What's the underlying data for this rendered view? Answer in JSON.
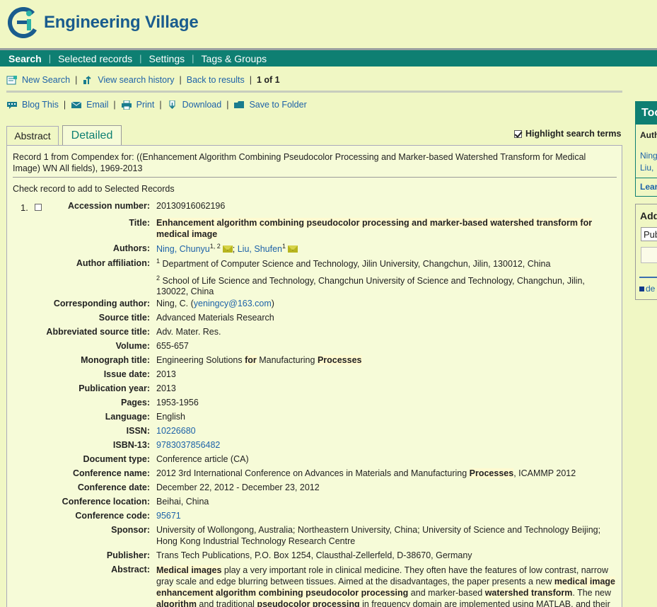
{
  "app": {
    "logo_text": "Engineering Village"
  },
  "nav": [
    "Search",
    "Selected records",
    "Settings",
    "Tags & Groups"
  ],
  "toolbar1": {
    "new_search": "New Search",
    "view_history": "View search history",
    "back": "Back to results",
    "count": "1 of 1"
  },
  "toolbar2": {
    "blog": "Blog This",
    "email": "Email",
    "print": "Print",
    "download": "Download",
    "save": "Save to Folder"
  },
  "tabs": {
    "abstract": "Abstract",
    "detailed": "Detailed"
  },
  "highlight_label": "Highlight search terms",
  "record_from": "Record 1 from Compendex for: ((Enhancement Algorithm Combining Pseudocolor Processing and Marker-based Watershed Transform for Medical Image) WN All fields), 1969-2013",
  "check_note": "Check record to add to Selected Records",
  "record_number": "1.",
  "labels": {
    "accession": "Accession number:",
    "title": "Title:",
    "authors": "Authors:",
    "affiliation": "Author affiliation:",
    "corresponding": "Corresponding author:",
    "source": "Source title:",
    "abbrev": "Abbreviated source title:",
    "volume": "Volume:",
    "monograph": "Monograph title:",
    "issue_date": "Issue date:",
    "pub_year": "Publication year:",
    "pages": "Pages:",
    "language": "Language:",
    "issn": "ISSN:",
    "isbn": "ISBN-13:",
    "doctype": "Document type:",
    "conf_name": "Conference name:",
    "conf_date": "Conference date:",
    "conf_loc": "Conference location:",
    "conf_code": "Conference code:",
    "sponsor": "Sponsor:",
    "publisher": "Publisher:",
    "abstract": "Abstract:"
  },
  "record": {
    "accession": "20130916062196",
    "title": "Enhancement algorithm combining pseudocolor processing and marker-based watershed transform for medical image",
    "author1": "Ning, Chunyu",
    "author1_sup": "1, 2",
    "author_sep": ";",
    "author2": "Liu, Shufen",
    "author2_sup": "1",
    "aff1_sup": "1",
    "aff1": "Department of Computer Science and Technology, Jilin University, Changchun, Jilin, 130012, China",
    "aff2_sup": "2",
    "aff2": "School of Life Science and Technology, Changchun University of Science and Technology, Changchun, Jilin, 130022, China",
    "corr_name": "Ning, C. (",
    "corr_email": "yeningcy@163.com",
    "corr_close": ")",
    "source": "Advanced Materials Research",
    "abbrev": "Adv. Mater. Res.",
    "volume": "655-657",
    "mono_a": "Engineering Solutions ",
    "mono_b": "for",
    "mono_c": " Manufacturing ",
    "mono_d": "Processes",
    "issue_date": "2013",
    "pub_year": "2013",
    "pages": "1953-1956",
    "language": "English",
    "issn": "10226680",
    "isbn": "9783037856482",
    "doctype": "Conference article (CA)",
    "conf_a": "2012 3rd International Conference on Advances in Materials and Manufacturing ",
    "conf_b": "Processes",
    "conf_c": ", ICAMMP 2012",
    "conf_date": "December 22, 2012 - December 23, 2012",
    "conf_loc": "Beihai, China",
    "conf_code": "95671",
    "sponsor": "University of Wollongong, Australia; Northeastern University, China; University of Science and Technology Beijing; Hong Kong Industrial Technology Research Centre",
    "publisher": "Trans Tech Publications, P.O. Box 1254, Clausthal-Zellerfeld, D-38670, Germany",
    "abs_1": "Medical images",
    "abs_2": " play a very important role in clinical medicine. They often have the features of low contrast, narrow gray scale and edge blurring between tissues. Aimed at the disadvantages, the paper presents a new ",
    "abs_3": "medical image enhancement algorithm combining pseudocolor processing",
    "abs_4": " and marker-based ",
    "abs_5": "watershed transform",
    "abs_6": ". The new ",
    "abs_7": "algorithm",
    "abs_8": " and traditional ",
    "abs_9": "pseudocolor processing",
    "abs_10": " in frequency domain are implemented using MATLAB, and their"
  },
  "side": {
    "tools_header": "Too",
    "auth_label": "Auth",
    "auth_link1": "Ning",
    "auth_link2": "Liu,",
    "learn": "Lear",
    "add_label": "Add",
    "select_val": "Pub",
    "del_link": "de"
  },
  "colors": {
    "background": "#f0f7c4",
    "nav": "#0e7f72",
    "link": "#1d62a8"
  }
}
